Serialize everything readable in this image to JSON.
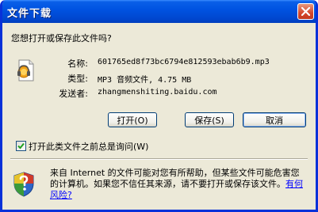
{
  "window": {
    "title": "文件下载"
  },
  "dialog": {
    "question": "您想打开或保存此文件吗?",
    "name_label": "名称:",
    "name_value": "601765ed8f73bc6794e812593ebab6b9.mp3",
    "type_label": "类型:",
    "type_value": "MP3 音频文件, 4.75 MB",
    "sender_label": "发送者:",
    "sender_value": "zhangmenshiting.baidu.com"
  },
  "buttons": {
    "open_label": "打开(O)",
    "save_label": "保存(S)",
    "cancel_label": "取消"
  },
  "checkbox": {
    "label": "打开此类文件之前总是询问(W)",
    "checked": true
  },
  "warning": {
    "text": "来自 Internet 的文件可能对您有所帮助，但某些文件可能危害您的计算机。如果您不信任其来源，请不要打开或保存该文件。",
    "link": "有何风险?"
  }
}
